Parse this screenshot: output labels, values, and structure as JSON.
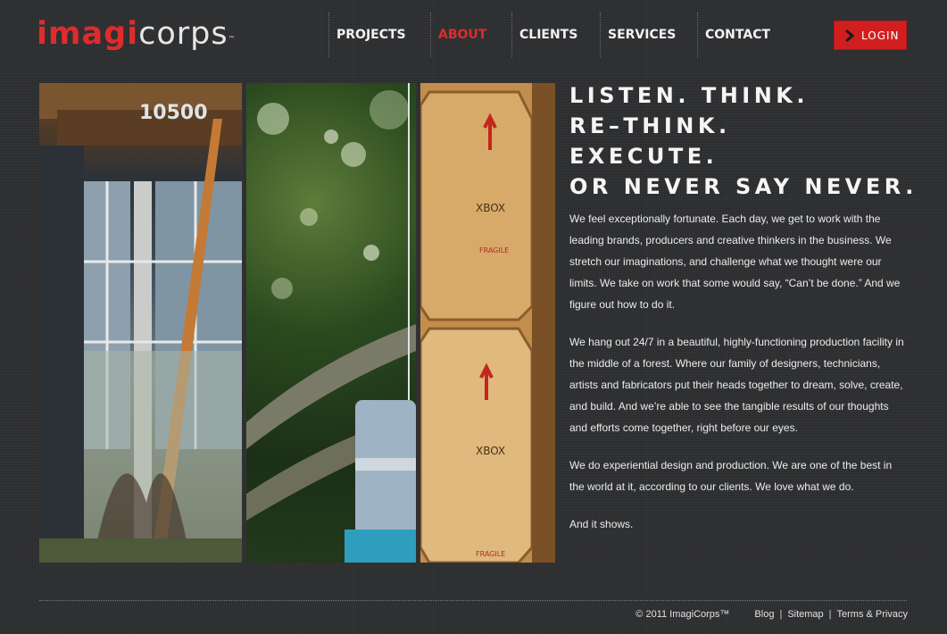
{
  "logo": {
    "part1": "imagi",
    "part2": "corps",
    "tm": "™"
  },
  "nav": {
    "items": [
      {
        "label": "PROJECTS",
        "active": false
      },
      {
        "label": "ABOUT",
        "active": true
      },
      {
        "label": "CLIENTS",
        "active": false
      },
      {
        "label": "SERVICES",
        "active": false
      },
      {
        "label": "CONTACT",
        "active": false
      }
    ]
  },
  "login": {
    "label": "LOGIN",
    "icon": "chevron-right-icon"
  },
  "hero": {
    "building_number": "10500",
    "crate_label": "XBOX",
    "crate_warning": "FRAGILE"
  },
  "headline": {
    "lines": [
      "LISTEN. THINK.",
      "RE–THINK.",
      "EXECUTE.",
      "OR NEVER SAY NEVER."
    ]
  },
  "body": {
    "paragraphs": [
      "We feel exceptionally fortunate. Each day, we get to work with the leading brands, producers and creative thinkers in the business. We stretch our imaginations, and challenge what we thought were our limits. We take on work that some would say, “Can’t be done.” And we figure out how to do it.",
      "We hang out 24/7 in a beautiful, highly-functioning production facility in the middle of a forest. Where our family of designers, technicians, artists and fabricators put their heads together to dream, solve, create, and build. And we’re able to see the tangible results of our thoughts and efforts come together, right before our eyes.",
      "We do experiential design and production. We are one of the best in the world at it, according to our clients. We love what we do.",
      "And it shows."
    ]
  },
  "footer": {
    "copyright": "© 2011 ImagiCorps™",
    "links": [
      "Blog",
      "Sitemap",
      "Terms & Privacy"
    ],
    "separator": "|"
  },
  "colors": {
    "accent": "#e02b2b",
    "background": "#2f3032",
    "text": "#e8e8e8"
  }
}
